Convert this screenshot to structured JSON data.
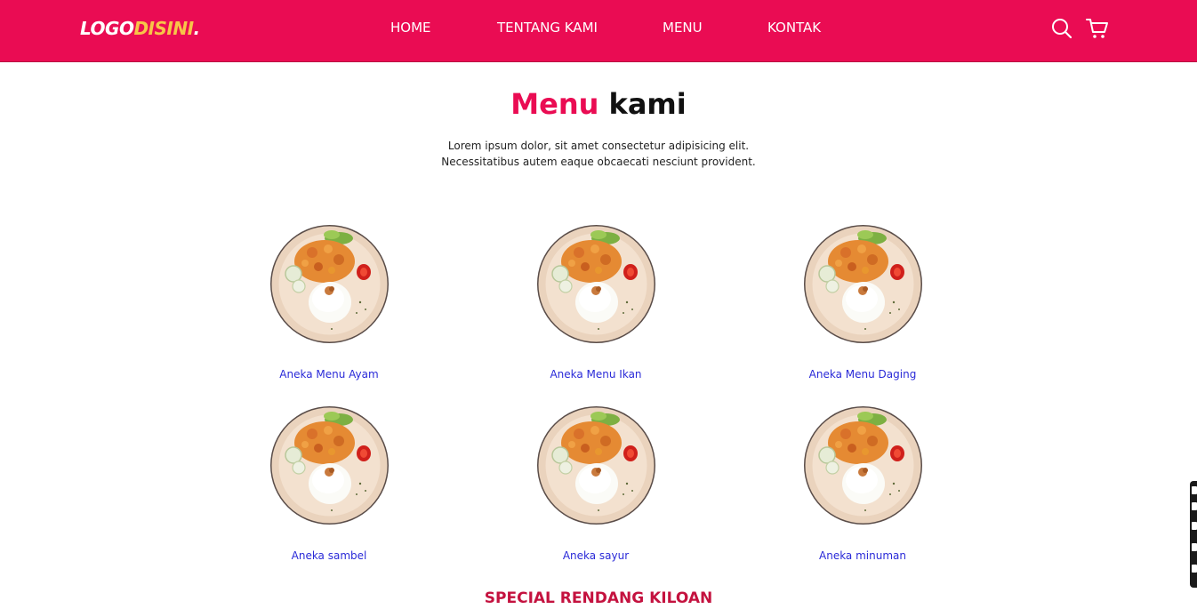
{
  "header": {
    "logo_main": "LOGO",
    "logo_accent": "DISINI",
    "logo_dot": ".",
    "nav": {
      "home": "HOME",
      "about": "TENTANG KAMI",
      "menu": "MENU",
      "contact": "KONTAK"
    },
    "icons": [
      "search-icon",
      "cart-icon"
    ]
  },
  "section": {
    "title_highlight": "Menu",
    "title_rest": "kami",
    "description_line1": "Lorem ipsum dolor, sit amet consectetur adipisicing elit.",
    "description_line2": "Necessitatibus autem eaque obcaecati nesciunt provident."
  },
  "menu_items": [
    {
      "label": "Aneka Menu Ayam"
    },
    {
      "label": "Aneka Menu Ikan"
    },
    {
      "label": "Aneka Menu Daging"
    },
    {
      "label": "Aneka sambel"
    },
    {
      "label": "Aneka sayur"
    },
    {
      "label": "Aneka minuman"
    }
  ],
  "special_title": "SPECIAL RENDANG KILOAN",
  "colors": {
    "brand": "#ea0c53",
    "logo_accent": "#f7c548",
    "link": "#2a2ad8",
    "special": "#c4123f"
  }
}
